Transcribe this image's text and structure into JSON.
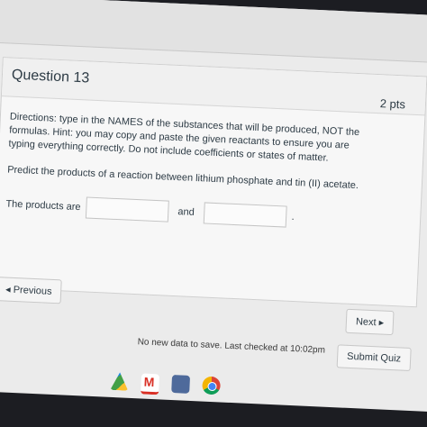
{
  "question": {
    "title": "Question 13",
    "points": "2 pts",
    "directions": "Directions: type in the NAMES of the substances that will be produced, NOT the formulas. Hint: you may copy and paste the given reactants to ensure you are typing everything correctly. Do not include coefficients or states of matter.",
    "prompt": "Predict the products of a reaction between lithium phosphate and tin (II) acetate.",
    "answer_label": "The products are",
    "and_label": "and",
    "end_punct": "."
  },
  "nav": {
    "previous_label": "◂ Previous",
    "next_label": "Next ▸"
  },
  "footer": {
    "status": "No new data to save. Last checked at 10:02pm",
    "submit_label": "Submit Quiz"
  },
  "dock": {
    "icons": [
      "drive-icon",
      "gmail-icon",
      "files-icon",
      "chrome-icon"
    ]
  }
}
